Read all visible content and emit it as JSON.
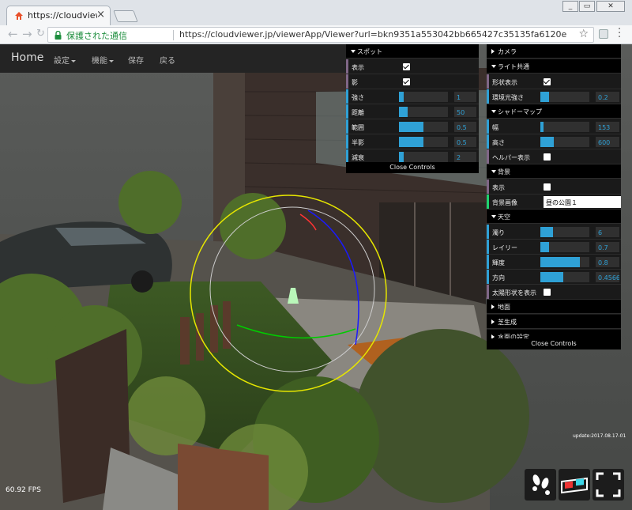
{
  "browser": {
    "tab_title": "https://cloudviewer.jp",
    "close_tab": "×",
    "secure_label": "保護された通信",
    "url": "https://cloudviewer.jp/viewerApp/Viewer?url=bkn9351a553042bb665427c35135fa6120e",
    "window_controls": [
      "_",
      "▭",
      "✕"
    ]
  },
  "app_nav": {
    "brand": "Home",
    "items": [
      "設定",
      "機能",
      "保存",
      "戻る"
    ]
  },
  "spot_panel": {
    "header": "スポット",
    "rows": [
      {
        "label": "表示",
        "type": "checkbox",
        "checked": true
      },
      {
        "label": "影",
        "type": "checkbox",
        "checked": true
      },
      {
        "label": "強さ",
        "type": "slider",
        "value": "1",
        "fraction": 0.09
      },
      {
        "label": "距離",
        "type": "slider",
        "value": "50",
        "fraction": 0.18
      },
      {
        "label": "範囲",
        "type": "slider",
        "value": "0.5",
        "fraction": 0.5
      },
      {
        "label": "半影",
        "type": "slider",
        "value": "0.5",
        "fraction": 0.5
      },
      {
        "label": "減衰",
        "type": "slider",
        "value": "2",
        "fraction": 0.1
      }
    ],
    "close": "Close Controls"
  },
  "right_panel": {
    "camera": "カメラ",
    "light_common": "ライト共通",
    "light_rows": [
      {
        "label": "形状表示",
        "type": "checkbox",
        "checked": true
      },
      {
        "label": "環境光強さ",
        "type": "slider",
        "value": "0.2",
        "fraction": 0.18
      }
    ],
    "shadow_map": "シャドーマップ",
    "shadow_rows": [
      {
        "label": "幅",
        "type": "slider",
        "value": "153",
        "fraction": 0.07
      },
      {
        "label": "高さ",
        "type": "slider",
        "value": "600",
        "fraction": 0.27
      },
      {
        "label": "ヘルパー表示",
        "type": "checkbox",
        "checked": false
      }
    ],
    "background": "背景",
    "bg_show": {
      "label": "表示",
      "checked": false
    },
    "bg_image": {
      "label": "背景画像",
      "value": "昼の公園１"
    },
    "sky": "天空",
    "sky_rows": [
      {
        "label": "濁り",
        "type": "slider",
        "value": "6",
        "fraction": 0.25
      },
      {
        "label": "レイリー",
        "type": "slider",
        "value": "0.7",
        "fraction": 0.18
      },
      {
        "label": "輝度",
        "type": "slider",
        "value": "0.8",
        "fraction": 0.8
      },
      {
        "label": "方向",
        "type": "slider",
        "value": "0.4566",
        "fraction": 0.46
      },
      {
        "label": "太陽形状を表示",
        "type": "checkbox",
        "checked": false
      }
    ],
    "folders_closed": [
      "地面",
      "芝生成",
      "水面の設定"
    ],
    "close": "Close Controls"
  },
  "overlay": {
    "fps": "60.92 FPS",
    "update": "update:2017.08.17-01"
  },
  "colors": {
    "gui_accent": "#2fa1d6",
    "gauge_yellow": "#e6e600",
    "gauge_blue": "#1a1aff",
    "gauge_green": "#00cc00",
    "gauge_red": "#ff3333"
  },
  "icons": [
    "footprints-icon",
    "3d-glasses-icon",
    "fullscreen-icon"
  ]
}
